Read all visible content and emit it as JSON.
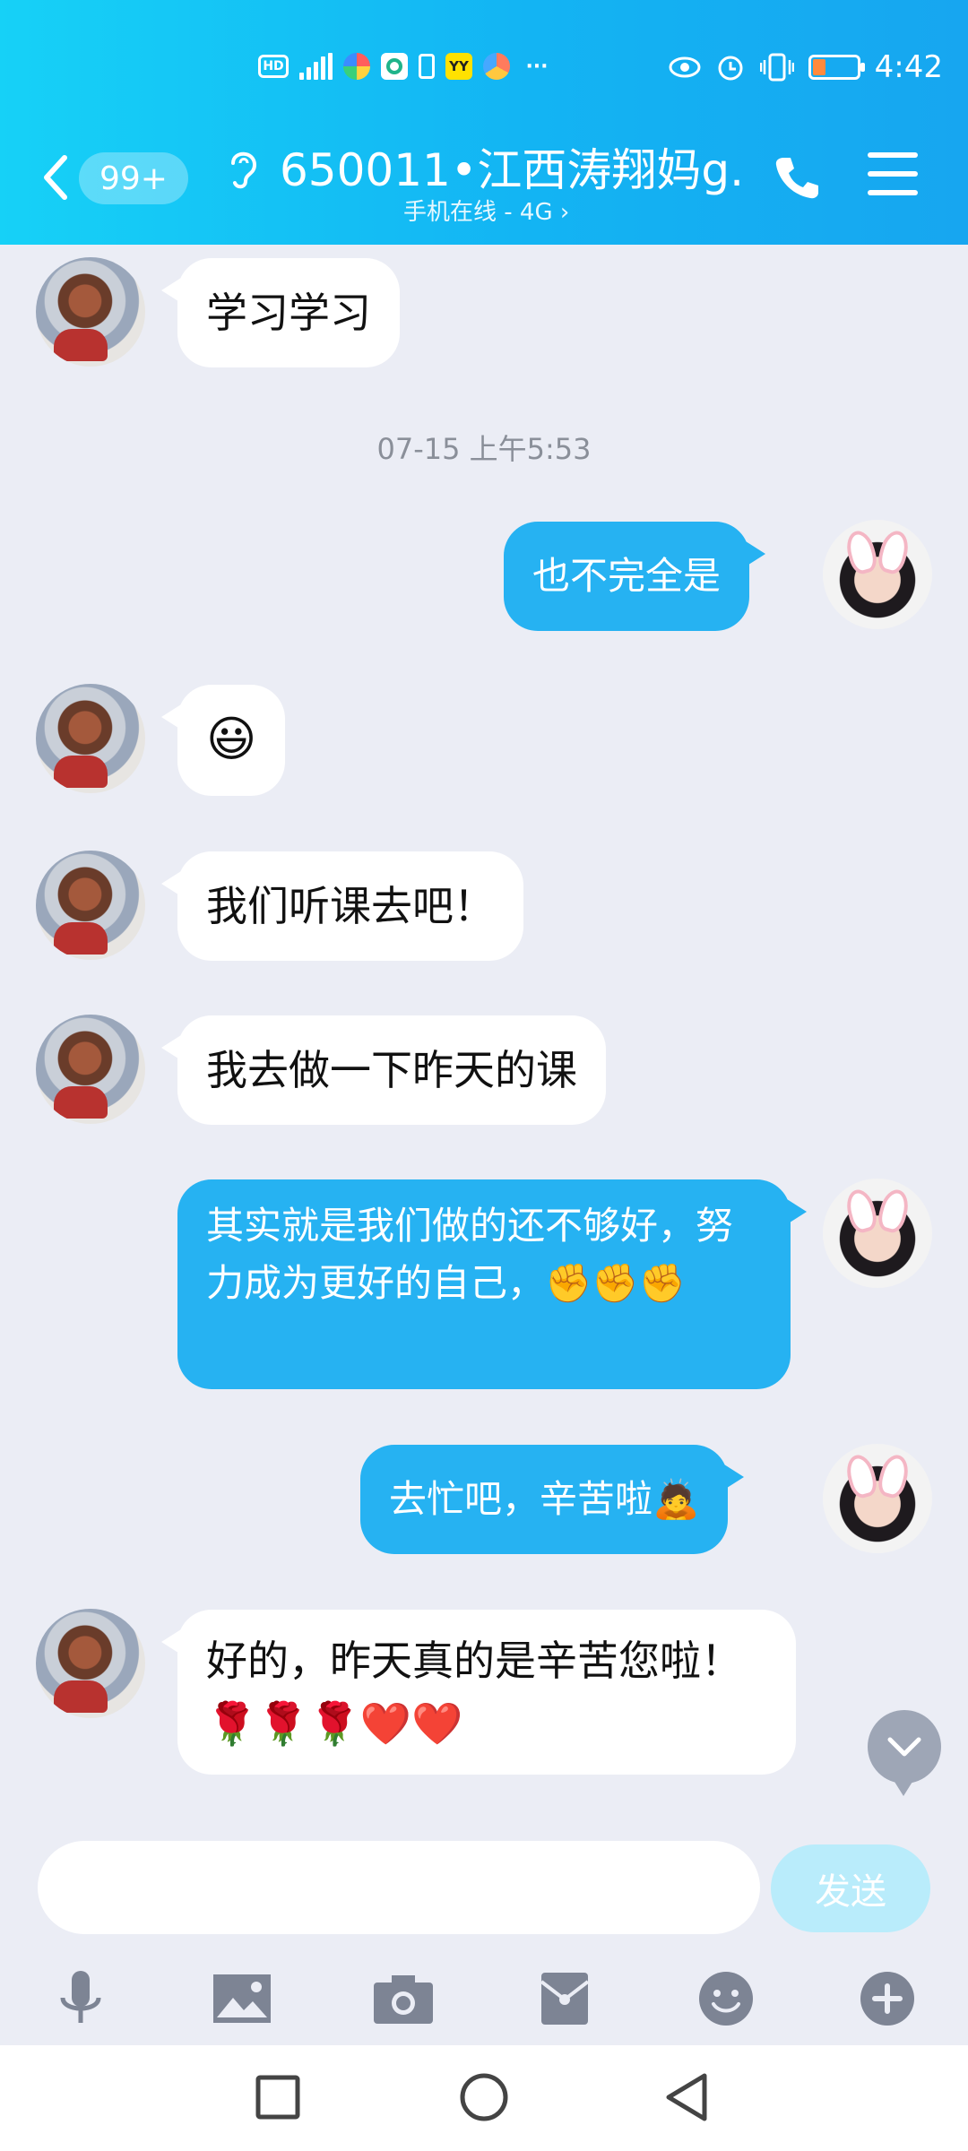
{
  "status_bar": {
    "time": "4:42",
    "left_icons": [
      "hd-icon",
      "4g-signal-icon",
      "app-icon",
      "app-icon",
      "battery-saver-icon",
      "yy-app-icon",
      "app-icon",
      "more-dots-icon"
    ],
    "hd_label": "HD",
    "yy_label": "YY",
    "more_label": "···",
    "right_icons": [
      "eye-icon",
      "alarm-icon",
      "vibrate-icon",
      "battery-icon"
    ],
    "battery_color": "#ff8a3d"
  },
  "header": {
    "back_icon": "chevron-left-icon",
    "badge": "99+",
    "ear_icon": "ear-icon",
    "title": "650011•江西涛翔妈g...",
    "subtitle": "手机在线 - 4G ›",
    "call_icon": "phone-icon",
    "menu_icon": "menu-icon",
    "gradient_colors": [
      "#16d1f7",
      "#17a6f0"
    ]
  },
  "timestamp": "07-15 上午5:53",
  "messages": [
    {
      "from": "other",
      "text": "学习学习"
    },
    {
      "from": "self",
      "text": "也不完全是"
    },
    {
      "from": "other",
      "text": "😃"
    },
    {
      "from": "other",
      "text": "我们听课去吧！"
    },
    {
      "from": "other",
      "text": "我去做一下昨天的课"
    },
    {
      "from": "self",
      "text": "其实就是我们做的还不够好，努力成为更好的自己，✊✊✊"
    },
    {
      "from": "self",
      "text": "去忙吧，辛苦啦🙇"
    },
    {
      "from": "other",
      "text": "好的，昨天真的是辛苦您啦！🌹🌹🌹❤️❤️"
    }
  ],
  "bubble_colors": {
    "incoming": "#ffffff",
    "outgoing": "#26b2f2"
  },
  "input": {
    "value": "",
    "placeholder": "",
    "send_label": "发送"
  },
  "toolbar_icons": [
    "microphone-icon",
    "image-icon",
    "camera-icon",
    "red-packet-icon",
    "emoji-icon",
    "plus-icon"
  ],
  "nav_icons": [
    "recents-square-icon",
    "home-circle-icon",
    "back-triangle-icon"
  ]
}
